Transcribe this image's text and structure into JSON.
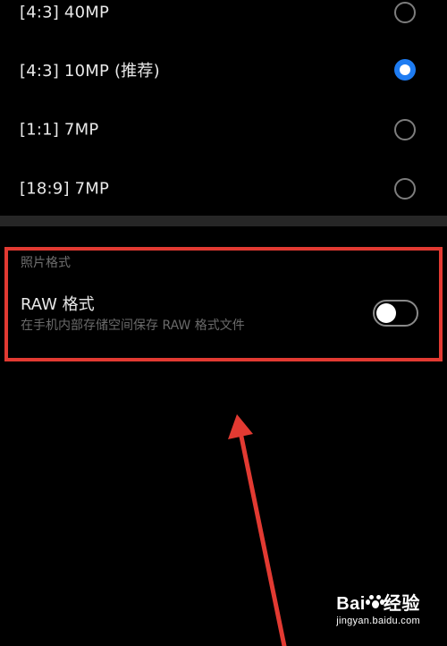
{
  "resolution_options": [
    {
      "label": "[4:3] 40MP",
      "selected": false
    },
    {
      "label": "[4:3] 10MP (推荐)",
      "selected": true
    },
    {
      "label": "[1:1] 7MP",
      "selected": false
    },
    {
      "label": "[18:9] 7MP",
      "selected": false
    }
  ],
  "photo_format": {
    "section_title": "照片格式",
    "raw_title": "RAW 格式",
    "raw_description": "在手机内部存储空间保存 RAW 格式文件",
    "raw_enabled": false
  },
  "watermark": {
    "brand_left": "Bai",
    "brand_right": "经验",
    "sub": "jingyan.baidu.com"
  },
  "colors": {
    "accent": "#1e7cf2",
    "annotation": "#e23a32",
    "background": "#000000"
  }
}
